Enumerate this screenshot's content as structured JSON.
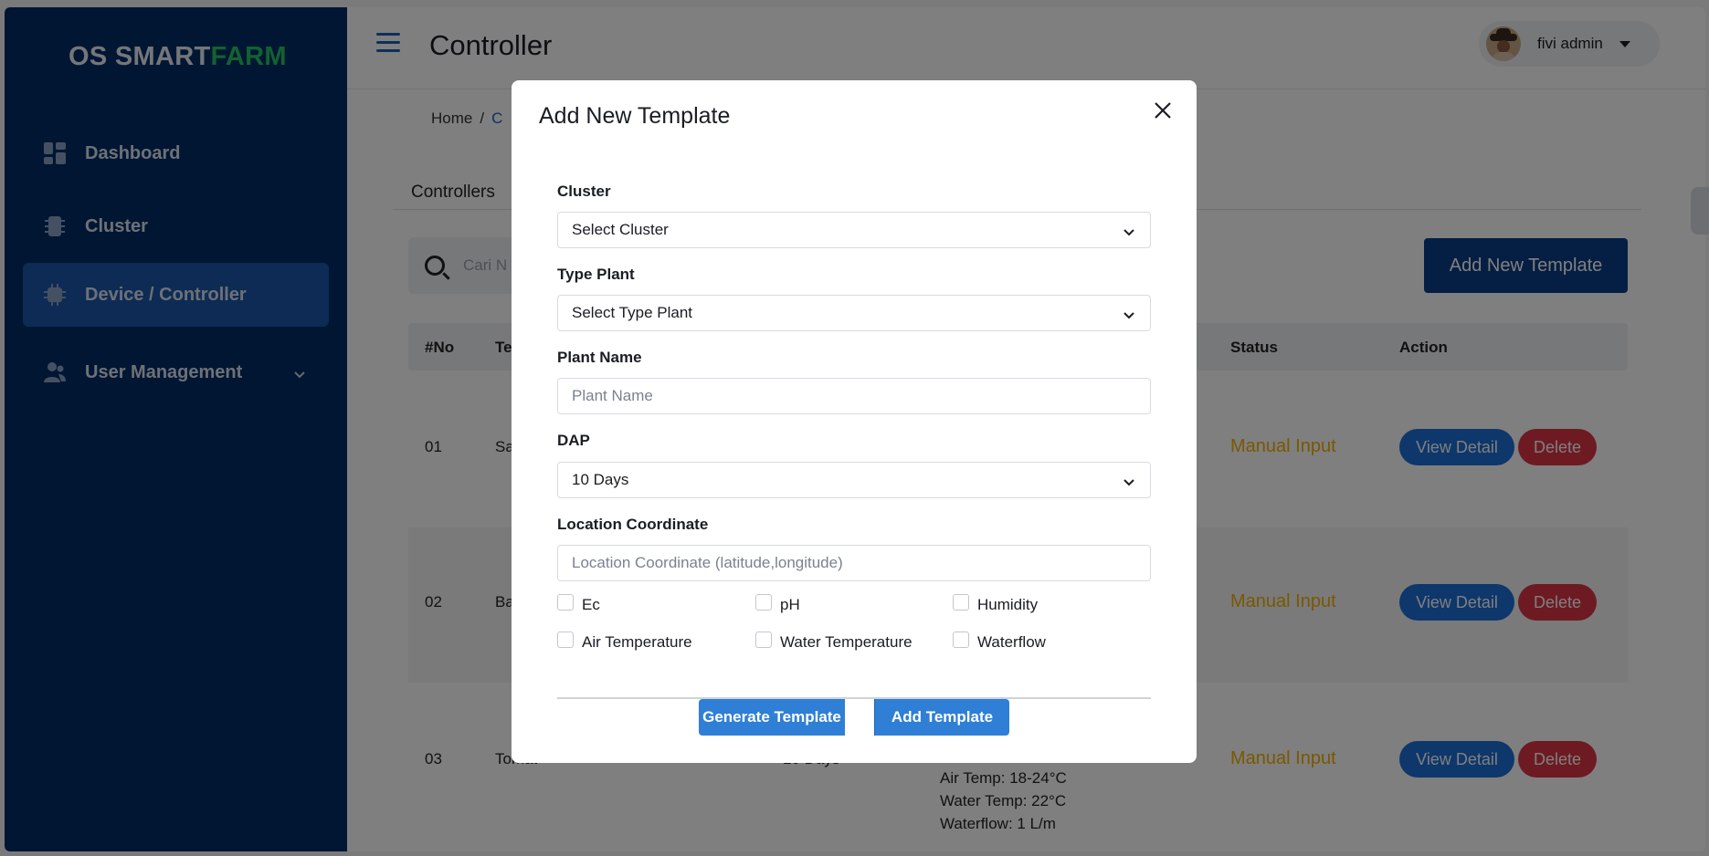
{
  "brand": {
    "part1": "OS SMART",
    "part2": "FARM"
  },
  "sidebar": {
    "items": [
      {
        "label": "Dashboard",
        "icon": "dashboard-icon"
      },
      {
        "label": "Cluster",
        "icon": "cluster-icon"
      },
      {
        "label": "Device / Controller",
        "icon": "chip-icon",
        "active": true
      },
      {
        "label": "User Management",
        "icon": "users-icon",
        "expandable": true
      }
    ]
  },
  "header": {
    "title": "Controller",
    "user_name": "fivi admin"
  },
  "breadcrumb": {
    "home": "Home",
    "separator": "/",
    "current": "C"
  },
  "tabs": {
    "active": "Controllers"
  },
  "search": {
    "placeholder": "Cari N"
  },
  "toolbar": {
    "add_template_label": "Add New Template"
  },
  "table": {
    "columns": {
      "no": "#No",
      "template": "Te",
      "status": "Status",
      "action": "Action"
    },
    "rows": [
      {
        "no": "01",
        "name": "Sa",
        "status": "Manual Input",
        "view": "View Detail",
        "delete": "Delete"
      },
      {
        "no": "02",
        "name": "Ba",
        "status": "Manual Input",
        "view": "View Detail",
        "delete": "Delete"
      },
      {
        "no": "03",
        "name": "Tomat",
        "dap": "10 Days",
        "status": "Manual Input",
        "view": "View Detail",
        "delete": "Delete",
        "params": [
          "Air Temp: 18-24°C",
          "Water Temp: 22°C",
          "Waterflow: 1 L/m"
        ]
      }
    ]
  },
  "modal": {
    "title": "Add New Template",
    "cluster_label": "Cluster",
    "cluster_value": "Select Cluster",
    "type_plant_label": "Type Plant",
    "type_plant_value": "Select Type Plant",
    "plant_name_label": "Plant Name",
    "plant_name_placeholder": "Plant Name",
    "dap_label": "DAP",
    "dap_value": "10 Days",
    "location_label": "Location Coordinate",
    "location_placeholder": "Location Coordinate (latitude,longitude)",
    "checkboxes": [
      "Ec",
      "pH",
      "Humidity",
      "Air Temperature",
      "Water Temperature",
      "Waterflow"
    ],
    "generate_label": "Generate Template",
    "add_label": "Add Template"
  },
  "colors": {
    "sidebar_bg": "#032c66",
    "accent": "#2e7fd5",
    "brand_green": "#26c262",
    "manual_input": "#f3b000",
    "delete": "#dc3545"
  }
}
